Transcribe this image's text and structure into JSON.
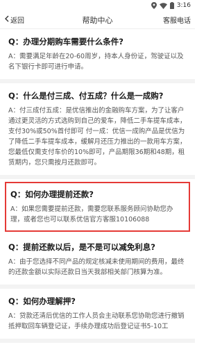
{
  "status_bar": {
    "time": "3:16",
    "icons": [
      "location-icon",
      "wifi-icon",
      "battery-icon"
    ]
  },
  "nav": {
    "back_label": "返回",
    "title": "帮助中心",
    "action_label": "客服电话"
  },
  "faqs": [
    {
      "q": "Q：办理分期购车需要什么条件?",
      "a": "A：需要满足年龄在20-60周岁，持本人身份证，驾驶证以及名下银行卡即可进行申请。"
    },
    {
      "q": "Q：什么是付三成、付五成？什么是一成购?",
      "a": "A：付三成付五成：是优信推出的金融购车方案，为了让客户通过更灵活的方式选购到自己的爱车，降低二手车提车成本，支付30%或50%首付即可 付一成：优信一成购产品是优信为了降低二手车提车成本，缓解月还压力推出的一款用车方案，您最低仅需支付车价的10%即可，产品期限36期和48期，租赁期内，您只需按月还款即可。"
    },
    {
      "q": "Q：如何办理提前还款?",
      "a": "A：如果您需要提前还款，需要您联系服务顾问协助您办理，或者您也可以联系优信官方客服10106088",
      "highlighted": true
    },
    {
      "q": "Q：提前还款以后，是不是可以减免利息?",
      "a": "A：由于您选择不同产品的规定核减未使用期间的费用，最终的还款金额以实际还款日当天我部相关部门核算为准。"
    },
    {
      "q": "Q：如何办理解押?",
      "a": "A：贷款还清后优信的工作人员会主动联系您协助您进行撤销抵押取回车辆登记证，手续办理成功后登记证书5-10工"
    }
  ],
  "colors": {
    "highlight_border": "#e53935",
    "separator": "#f3f3f3"
  }
}
